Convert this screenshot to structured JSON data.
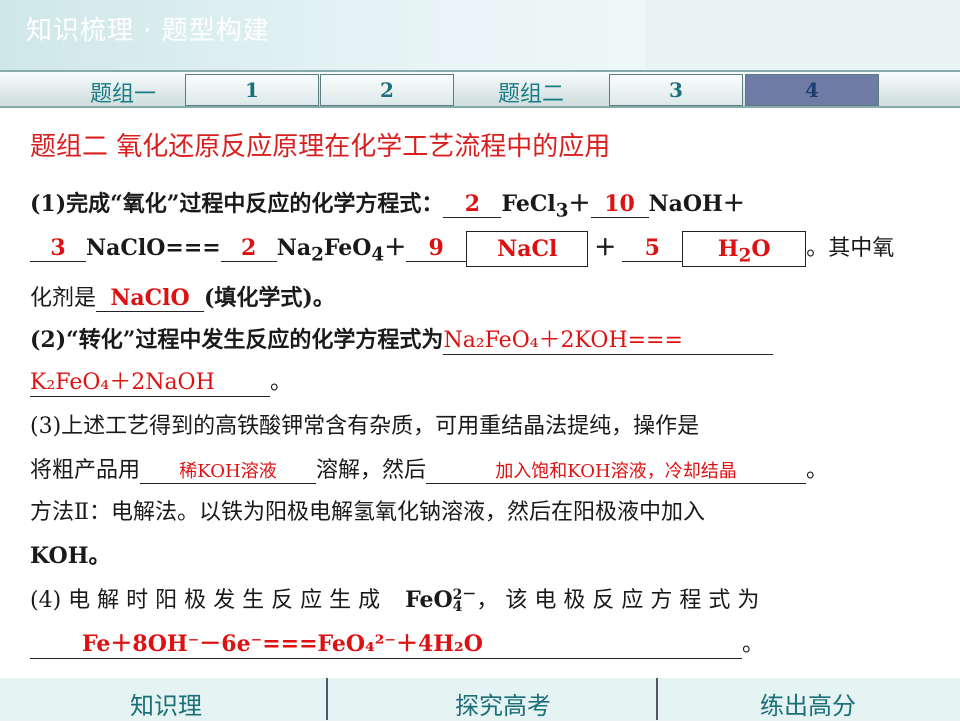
{
  "header": {
    "title": "知识梳理 · 题型构建"
  },
  "tabs": {
    "group1": "题组一",
    "t1": "1",
    "t2": "2",
    "group2": "题组二",
    "t3": "3",
    "t4": "4"
  },
  "content": {
    "heading": "题组二  氧化还原反应原理在化学工艺流程中的应用",
    "q1": {
      "text_a": "(1)完成“氧化”过程中反应的化学方程式：",
      "a1": "2",
      "fecl3": "FeCl",
      "sub3": "3",
      "plus": "＋",
      "a2": "10",
      "naoh": "NaOH＋",
      "a3": "3",
      "naclo_eq": "NaClO===",
      "a4": "2",
      "na2feo4": "Na",
      "sub2": "2",
      "feo": "FeO",
      "sub4": "4",
      "plus2": "＋",
      "a5": "9",
      "nacl": "NaCl",
      "plus3": "＋",
      "a6": "5",
      "h2o_h": "H",
      "h2o_2": "2",
      "h2o_o": "O",
      "tail": "。其中氧",
      "line3_a": "化剂是",
      "oxidant": "NaClO",
      "line3_b": "(填化学式)。"
    },
    "q2": {
      "text": "(2)“转化”过程中发生反应的化学方程式为",
      "eq1": "Na₂FeO₄＋2KOH===",
      "eq2": "K₂FeO₄＋2NaOH",
      "end": "。"
    },
    "q3": {
      "text1": "(3)上述工艺得到的高铁酸钾常含有杂质，可用重结晶法提纯，操作是",
      "text2a": "将粗产品用",
      "ans1": "稀KOH溶液",
      "text2b": "溶解，然后",
      "ans2": "加入饱和KOH溶液，冷却结晶",
      "text2c": "。",
      "text3": "方法Ⅱ：电解法。以铁为阳极电解氢氧化钠溶液，然后在阳极液中加入",
      "text4": "KOH。"
    },
    "q4": {
      "text": "(4) 电 解 时 阳 极 发 生 反 应 生 成",
      "ion": "FeO",
      "ion_sup": "2－",
      "ion_sub": "4",
      "text_b": "， 该 电 极 反 应 方 程 式 为",
      "eq": "Fe＋8OH⁻－6e⁻===FeO₄²⁻＋4H₂O",
      "end": "。"
    }
  },
  "nav": {
    "item1": "知识理",
    "item2": "探究高考",
    "item3": "练出高分"
  }
}
